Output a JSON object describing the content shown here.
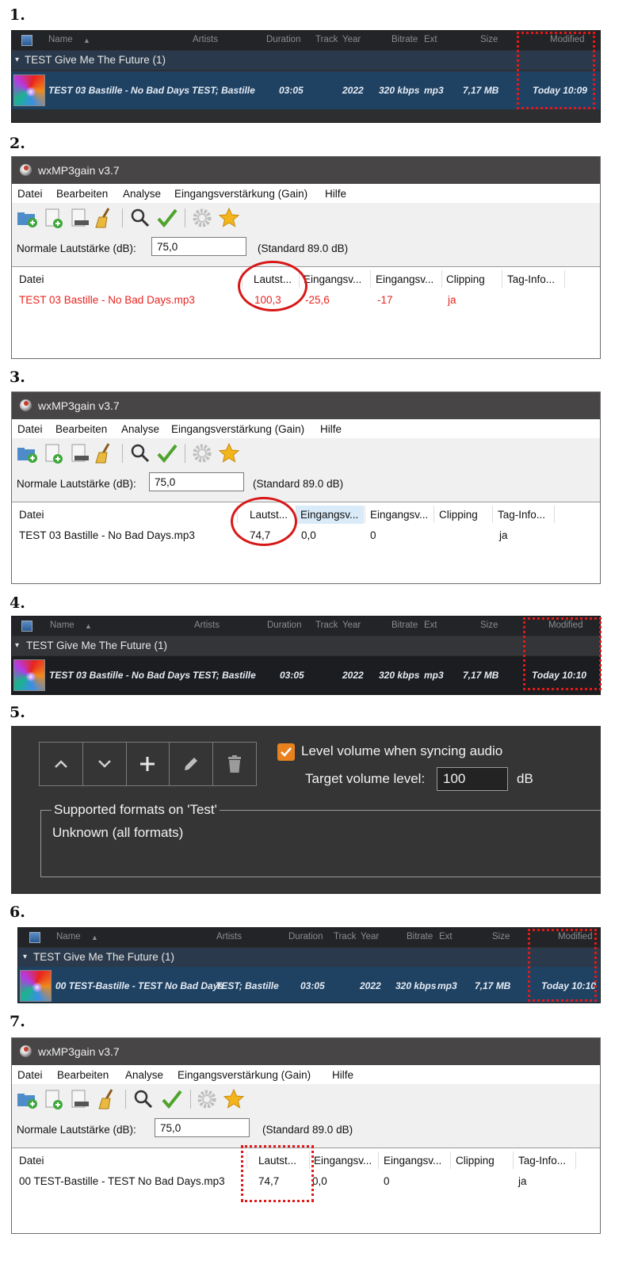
{
  "steps": [
    "1.",
    "2.",
    "3.",
    "4.",
    "5.",
    "6.",
    "7."
  ],
  "library_columns": {
    "name": "Name",
    "artists": "Artists",
    "duration": "Duration",
    "track": "Track",
    "year": "Year",
    "bitrate": "Bitrate",
    "ext": "Ext",
    "size": "Size",
    "modified": "Modified"
  },
  "sort_indicator": "▲",
  "group_title": "TEST Give Me The Future (1)",
  "group_chevron": "▾",
  "library1": {
    "title": "TEST 03 Bastille - No Bad Days",
    "artists": "TEST; Bastille",
    "duration": "03:05",
    "year": "2022",
    "bitrate": "320 kbps",
    "ext": "mp3",
    "size": "7,17 MB",
    "modified": "Today  10:09"
  },
  "library4": {
    "title": "TEST 03 Bastille - No Bad Days",
    "artists": "TEST; Bastille",
    "duration": "03:05",
    "year": "2022",
    "bitrate": "320 kbps",
    "ext": "mp3",
    "size": "7,17 MB",
    "modified": "Today  10:10"
  },
  "library6": {
    "title": "00 TEST-Bastille - TEST No Bad Days",
    "artists": "TEST; Bastille",
    "duration": "03:05",
    "year": "2022",
    "bitrate": "320 kbps",
    "ext": "mp3",
    "size": "7,17 MB",
    "modified": "Today  10:10"
  },
  "mp3gain": {
    "title": "wxMP3gain v3.7",
    "menu": [
      "Datei",
      "Bearbeiten",
      "Analyse",
      "Eingangsverstärkung (Gain)",
      "Hilfe"
    ],
    "volume_label": "Normale Lautstärke (dB):",
    "volume_value": "75,0",
    "standard": "(Standard 89.0 dB)",
    "columns": [
      "Datei",
      "Lautst...",
      "Eingangsv...",
      "Eingangsv...",
      "Clipping",
      "Tag-Info..."
    ]
  },
  "win2_row": [
    "TEST 03 Bastille - No Bad Days.mp3",
    "100,3",
    "-25,6",
    "-17",
    "ja",
    ""
  ],
  "win3_row": [
    "TEST 03 Bastille - No Bad Days.mp3",
    "74,7",
    "0,0",
    "0",
    "",
    "ja"
  ],
  "win7_row": [
    "00 TEST-Bastille - TEST No Bad Days.mp3",
    "74,7",
    "0,0",
    "0",
    "",
    "ja"
  ],
  "settings": {
    "level_volume_label": "Level volume when syncing audio",
    "level_volume_checked": true,
    "target_label": "Target volume level:",
    "target_value": "100",
    "target_unit": "dB",
    "formats_legend": "Supported formats on 'Test'",
    "formats_value": "Unknown (all formats)"
  },
  "colors": {
    "accent_orange": "#e8821e",
    "highlight_red": "#d81818",
    "selected_row": "#1f4263",
    "clip_red": "#e8241f"
  }
}
